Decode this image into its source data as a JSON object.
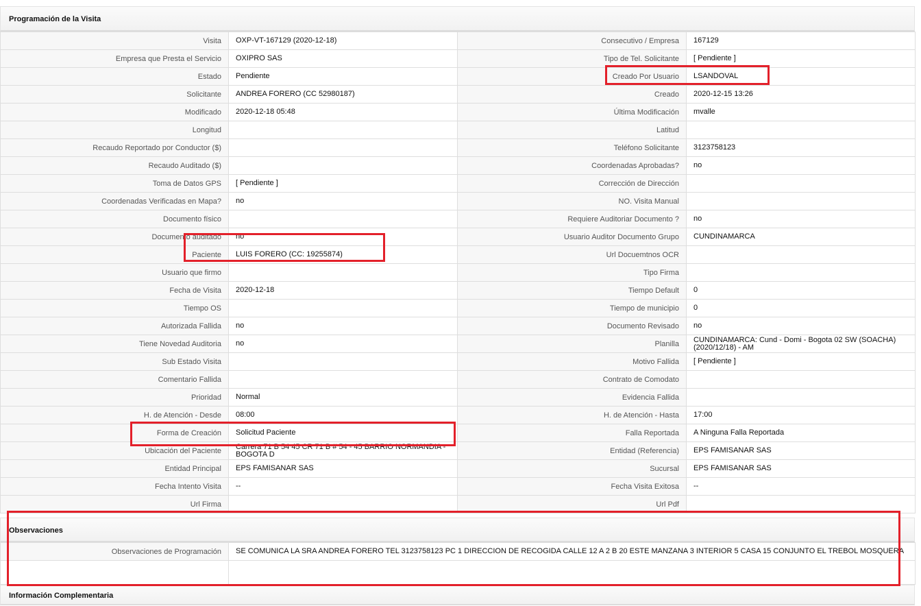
{
  "sections": {
    "programacion": "Programación de la Visita",
    "observaciones": "Observaciones",
    "informacion": "Información Complementaria"
  },
  "rows": [
    [
      {
        "l": "Visita",
        "v": "OXP-VT-167129 (2020-12-18)"
      },
      {
        "l": "Consecutivo / Empresa",
        "v": "167129"
      }
    ],
    [
      {
        "l": "Empresa que Presta el Servicio",
        "v": "OXIPRO SAS"
      },
      {
        "l": "Tipo de Tel. Solicitante",
        "v": "[ Pendiente ]"
      }
    ],
    [
      {
        "l": "Estado",
        "v": "Pendiente"
      },
      {
        "l": "Creado Por Usuario",
        "v": "LSANDOVAL"
      }
    ],
    [
      {
        "l": "Solicitante",
        "v": "ANDREA FORERO (CC 52980187)"
      },
      {
        "l": "Creado",
        "v": "2020-12-15 13:26"
      }
    ],
    [
      {
        "l": "Modificado",
        "v": "2020-12-18 05:48"
      },
      {
        "l": "Última Modificación",
        "v": " mvalle"
      }
    ],
    [
      {
        "l": "Longitud",
        "v": ""
      },
      {
        "l": "Latitud",
        "v": ""
      }
    ],
    [
      {
        "l": "Recaudo Reportado por Conductor ($)",
        "v": ""
      },
      {
        "l": "Teléfono Solicitante",
        "v": "3123758123"
      }
    ],
    [
      {
        "l": "Recaudo Auditado ($)",
        "v": ""
      },
      {
        "l": "Coordenadas Aprobadas?",
        "v": " no"
      }
    ],
    [
      {
        "l": "Toma de Datos GPS",
        "v": "[ Pendiente ]"
      },
      {
        "l": "Corrección de Dirección",
        "v": ""
      }
    ],
    [
      {
        "l": "Coordenadas Verificadas en Mapa?",
        "v": " no"
      },
      {
        "l": "NO. Visita Manual",
        "v": ""
      }
    ],
    [
      {
        "l": "Documento físico",
        "v": ""
      },
      {
        "l": "Requiere Auditoriar Documento ?",
        "v": " no"
      }
    ],
    [
      {
        "l": "Documento auditado",
        "v": " no"
      },
      {
        "l": "Usuario Auditor Documento Grupo",
        "v": "CUNDINAMARCA"
      }
    ],
    [
      {
        "l": "Paciente",
        "v": "LUIS FORERO (CC: 19255874)"
      },
      {
        "l": "Url Docuemtnos OCR",
        "v": ""
      }
    ],
    [
      {
        "l": "Usuario que firmo",
        "v": ""
      },
      {
        "l": "Tipo Firma",
        "v": ""
      }
    ],
    [
      {
        "l": "Fecha de Visita",
        "v": " 2020-12-18"
      },
      {
        "l": "Tiempo Default",
        "v": "0"
      }
    ],
    [
      {
        "l": "Tiempo OS",
        "v": ""
      },
      {
        "l": "Tiempo de municipio",
        "v": "0"
      }
    ],
    [
      {
        "l": "Autorizada Fallida",
        "v": " no"
      },
      {
        "l": "Documento Revisado",
        "v": " no"
      }
    ],
    [
      {
        "l": "Tiene Novedad Auditoria",
        "v": " no"
      },
      {
        "l": "Planilla",
        "v": "CUNDINAMARCA: Cund - Domi - Bogota 02 SW (SOACHA) (2020/12/18) - AM"
      }
    ],
    [
      {
        "l": "Sub Estado Visita",
        "v": ""
      },
      {
        "l": "Motivo Fallida",
        "v": "[ Pendiente ]"
      }
    ],
    [
      {
        "l": "Comentario Fallida",
        "v": ""
      },
      {
        "l": "Contrato de Comodato",
        "v": ""
      }
    ],
    [
      {
        "l": "Prioridad",
        "v": "Normal"
      },
      {
        "l": "Evidencia Fallida",
        "v": ""
      }
    ],
    [
      {
        "l": "H. de Atención - Desde",
        "v": "08:00"
      },
      {
        "l": "H. de Atención - Hasta",
        "v": "17:00"
      }
    ],
    [
      {
        "l": "Forma de Creación",
        "v": "Solicitud Paciente"
      },
      {
        "l": "Falla Reportada",
        "v": "A Ninguna Falla Reportada"
      }
    ],
    [
      {
        "l": "Ubicación del Paciente",
        "v": "Carrera 71 B 54 45 CR 71 B # 54 - 45 BARRIO NORMANDIA - BOGOTA D"
      },
      {
        "l": "Entidad (Referencia)",
        "v": "EPS FAMISANAR SAS"
      }
    ],
    [
      {
        "l": "Entidad Principal",
        "v": "EPS FAMISANAR SAS"
      },
      {
        "l": "Sucursal",
        "v": "EPS FAMISANAR SAS"
      }
    ],
    [
      {
        "l": "Fecha Intento Visita",
        "v": " --"
      },
      {
        "l": "Fecha Visita Exitosa",
        "v": " --"
      }
    ],
    [
      {
        "l": "Url Firma",
        "v": ""
      },
      {
        "l": "Url Pdf",
        "v": ""
      }
    ]
  ],
  "observaciones": {
    "label": "Observaciones de Programación",
    "value": "  SE COMUNICA LA SRA ANDREA FORERO TEL 3123758123 PC 1 DIRECCION DE RECOGIDA CALLE 12 A 2 B 20 ESTE MANZANA 3 INTERIOR 5 CASA 15 CONJUNTO EL TREBOL MOSQUERA"
  },
  "highlight_color": "#e3202a"
}
